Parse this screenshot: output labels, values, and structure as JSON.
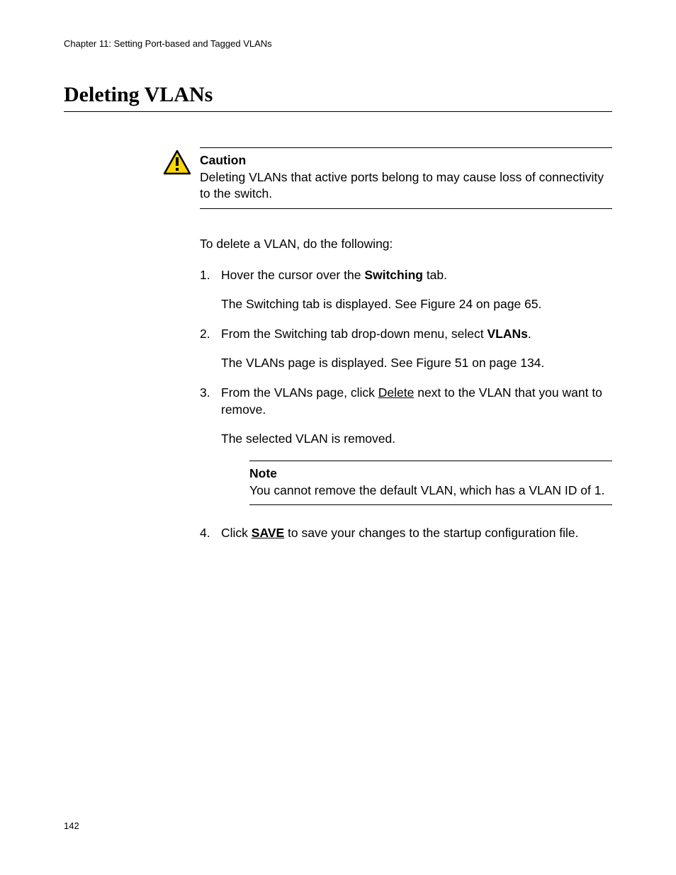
{
  "header": {
    "chapter": "Chapter 11: Setting Port-based and Tagged VLANs"
  },
  "title": "Deleting VLANs",
  "caution": {
    "label": "Caution",
    "text": "Deleting VLANs that active ports belong to may cause loss of connectivity to the switch."
  },
  "intro": "To delete a VLAN, do the following:",
  "steps": {
    "s1": {
      "num": "1.",
      "pre": "Hover the cursor over the ",
      "bold": "Switching",
      "post": " tab.",
      "result": "The Switching tab is displayed. See Figure 24 on page 65."
    },
    "s2": {
      "num": "2.",
      "pre": "From the Switching tab drop-down menu, select ",
      "bold": "VLANs",
      "post": ".",
      "result": "The VLANs page is displayed. See Figure 51 on page 134."
    },
    "s3": {
      "num": "3.",
      "pre": "From the VLANs page, click ",
      "link": "Delete",
      "post": " next to the VLAN that you want to remove.",
      "result": "The selected VLAN is removed."
    },
    "s4": {
      "num": "4.",
      "pre": "Click ",
      "bold_link": "SAVE",
      "post": " to save your changes to the startup configuration file."
    }
  },
  "note": {
    "label": "Note",
    "text": "You cannot remove the default VLAN, which has a VLAN ID of 1."
  },
  "page_number": "142"
}
